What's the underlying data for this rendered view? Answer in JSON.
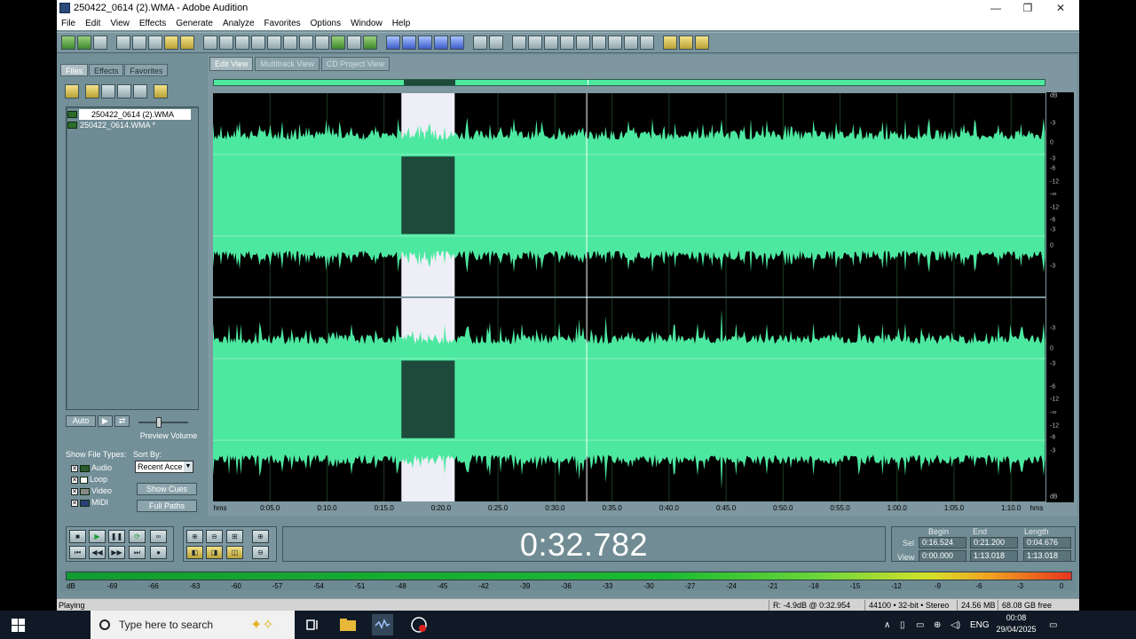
{
  "window": {
    "title": "250422_0614 (2).WMA - Adobe Audition",
    "controls": [
      "—",
      "❐",
      "✕"
    ]
  },
  "menu": [
    "File",
    "Edit",
    "View",
    "Effects",
    "Generate",
    "Analyze",
    "Favorites",
    "Options",
    "Window",
    "Help"
  ],
  "left_panel": {
    "tabs": [
      "Files",
      "Effects",
      "Favorites"
    ],
    "files": [
      "250422_0614 (2).WMA",
      "250422_0614.WMA *"
    ],
    "auto_label": "Auto",
    "preview_volume_label": "Preview Volume",
    "show_file_types_label": "Show File Types:",
    "file_types": [
      "Audio",
      "Loop",
      "Video",
      "MIDI"
    ],
    "sort_by_label": "Sort By:",
    "sort_by_value": "Recent Acce",
    "show_cues_label": "Show Cues",
    "full_paths_label": "Full Paths"
  },
  "view_tabs": [
    "Edit View",
    "Multitrack View",
    "CD Project View"
  ],
  "waveform": {
    "color": "#4de8a0",
    "selection_start": 16.524,
    "selection_end": 21.2,
    "cursor_time": 32.782,
    "duration": 73.018,
    "ruler_labels": [
      "hms",
      "0:05.0",
      "0:10.0",
      "0:15.0",
      "0:20.0",
      "0:25.0",
      "0:30.0",
      "0:35.0",
      "0:40.0",
      "0:45.0",
      "0:50.0",
      "0:55.0",
      "1:00.0",
      "1:05.0",
      "1:10.0",
      "hms"
    ],
    "db_labels": [
      "dB",
      "-3",
      "0",
      "-3",
      "-6",
      "-12",
      "-∞",
      "-12",
      "-6",
      "-3",
      "0",
      "-3",
      "dB"
    ]
  },
  "time_display": "0:32.782",
  "selection_panel": {
    "headers": [
      "Begin",
      "End",
      "Length"
    ],
    "sel_label": "Sel",
    "view_label": "View",
    "sel": [
      "0:16.524",
      "0:21.200",
      "0:04.676"
    ],
    "view": [
      "0:00.000",
      "1:13.018",
      "1:13.018"
    ]
  },
  "meter_labels": [
    "dB",
    "-69",
    "-66",
    "-63",
    "-60",
    "-57",
    "-54",
    "-51",
    "-48",
    "-45",
    "-42",
    "-39",
    "-36",
    "-33",
    "-30",
    "-27",
    "-24",
    "-21",
    "-18",
    "-15",
    "-12",
    "-9",
    "-6",
    "-3",
    "0"
  ],
  "status": {
    "state": "Playing",
    "level": "R: -4.9dB @  0:32.954",
    "format": "44100 • 32-bit • Stereo",
    "size": "24.56 MB",
    "free": "68.08 GB free"
  },
  "taskbar": {
    "search_placeholder": "Type here to search",
    "lang": "ENG",
    "time": "00:08",
    "date": "29/04/2025"
  }
}
